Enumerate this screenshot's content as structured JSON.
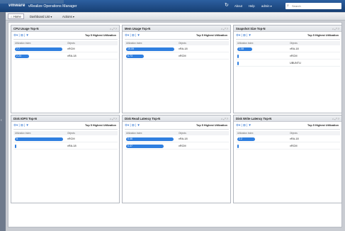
{
  "header": {
    "brand": "vmware",
    "app_name": "vRealize Operations Manager",
    "about": "About",
    "help": "Help",
    "user_menu": "admin ▾",
    "search_placeholder": "Search",
    "refresh_icon": "refresh-icon",
    "search_icon": "search-icon"
  },
  "toolbar": {
    "home": "Home",
    "dashboard_list": "Dashboard List ▾",
    "actions": "Actions ▾"
  },
  "colors": {
    "header_bg": "#1f4f8c",
    "bar": "#2f7fe0"
  },
  "widgets": [
    {
      "title": "CPU Usage Top-N",
      "mode": "Top 5 Highest Utilization",
      "col_metric": "Utilization Index",
      "col_object": "Objects",
      "rows": [
        {
          "value": "7.7",
          "object": "vRCM",
          "fill": 0.95
        },
        {
          "value": "2.23",
          "object": "vRA-18",
          "fill": 0.28
        }
      ]
    },
    {
      "title": "Mem Usage Top-N",
      "mode": "Top 5 Highest Utilization",
      "col_metric": "Utilization Index",
      "col_object": "Objects",
      "rows": [
        {
          "value": "19.09",
          "object": "vRA-18",
          "fill": 0.97
        },
        {
          "value": "6.73",
          "object": "vRCM",
          "fill": 0.36
        }
      ]
    },
    {
      "title": "Snapshot Size Top-N",
      "mode": "Top 5 Highest Utilization",
      "col_metric": "Utilization Index",
      "col_object": "Objects",
      "rows": [
        {
          "value": "1.08",
          "object": "vRA-18",
          "fill": 0.3
        },
        {
          "value": "",
          "object": "vRCM",
          "fill": 0.03
        },
        {
          "value": "",
          "object": "UBUNTU",
          "fill": 0.03
        }
      ]
    },
    {
      "title": "Disk IOPS Top-N",
      "mode": "Top 5 Highest Utilization",
      "col_metric": "Utilization Index",
      "col_object": "Objects",
      "rows": [
        {
          "value": "5",
          "object": "vRCM",
          "fill": 0.97
        },
        {
          "value": "",
          "object": "vRA-18",
          "fill": 0.03
        }
      ]
    },
    {
      "title": "Disk Read Latency Top-N",
      "mode": "Top 5 Highest Utilization",
      "col_metric": "Utilization Index",
      "col_object": "Objects",
      "rows": [
        {
          "value": "0.46",
          "object": "vRA-18",
          "fill": 0.96
        },
        {
          "value": "0.37",
          "object": "vRCM",
          "fill": 0.76
        }
      ]
    },
    {
      "title": "Disk Write Latency Top-N",
      "mode": "Top 5 Highest Utilization",
      "col_metric": "Utilization Index",
      "col_object": "Objects",
      "rows": [
        {
          "value": "2.2",
          "object": "vRA-18",
          "fill": 0.35
        },
        {
          "value": "",
          "object": "vRCM",
          "fill": 0.03
        }
      ]
    }
  ]
}
